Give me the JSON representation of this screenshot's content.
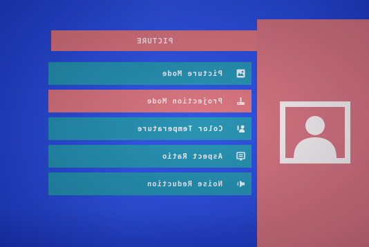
{
  "screen": {
    "title": "PICTURE",
    "menu": [
      {
        "label": "Picture Mode",
        "icon": "picture-icon",
        "selected": false
      },
      {
        "label": "Projection Mode",
        "icon": "projection-icon",
        "selected": true
      },
      {
        "label": "Color Temperature",
        "icon": "color-temperature-icon",
        "selected": false
      },
      {
        "label": "Aspect Ratio",
        "icon": "aspect-ratio-icon",
        "selected": false
      },
      {
        "label": "Noise Reduction",
        "icon": "noise-reduction-icon",
        "selected": false
      }
    ],
    "preview_icon": "user-avatar-icon"
  },
  "colors": {
    "background": "#2447dc",
    "menu_item": "#1e8fb0",
    "highlight": "#d9707a",
    "panel": "#d46f7c",
    "preview_frame": "#f4eef0"
  }
}
